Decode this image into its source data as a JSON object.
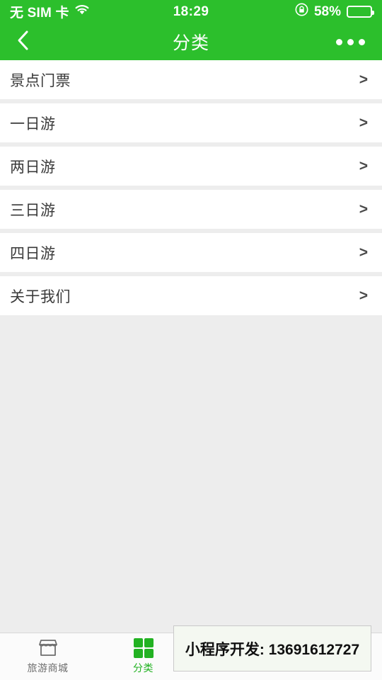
{
  "colors": {
    "brand_green": "#2cbf2c",
    "tab_active_green": "#22b222",
    "page_background": "#ededed",
    "row_background": "#ffffff"
  },
  "status_bar": {
    "carrier": "无 SIM 卡",
    "wifi_icon": "wifi-icon",
    "time": "18:29",
    "lock_icon": "rotation-lock-icon",
    "battery_percent": "58%",
    "battery_level": 58,
    "battery_icon": "battery-icon"
  },
  "nav_bar": {
    "back_icon": "chevron-left-icon",
    "title": "分类",
    "menu_icon": "more-horizontal-icon"
  },
  "list": {
    "items": [
      {
        "label": "景点门票",
        "chevron": ">"
      },
      {
        "label": "一日游",
        "chevron": ">"
      },
      {
        "label": "两日游",
        "chevron": ">"
      },
      {
        "label": "三日游",
        "chevron": ">"
      },
      {
        "label": "四日游",
        "chevron": ">"
      },
      {
        "label": "关于我们",
        "chevron": ">"
      }
    ]
  },
  "tab_bar": {
    "items": [
      {
        "label": "旅游商城",
        "icon": "shop-icon",
        "active": false
      },
      {
        "label": "分类",
        "icon": "grid-icon",
        "active": true
      },
      {
        "label": "",
        "icon": "obscured-icon",
        "active": false
      },
      {
        "label": "",
        "icon": "obscured-icon",
        "active": false
      }
    ]
  },
  "watermark": {
    "text": "小程序开发: 13691612727"
  }
}
